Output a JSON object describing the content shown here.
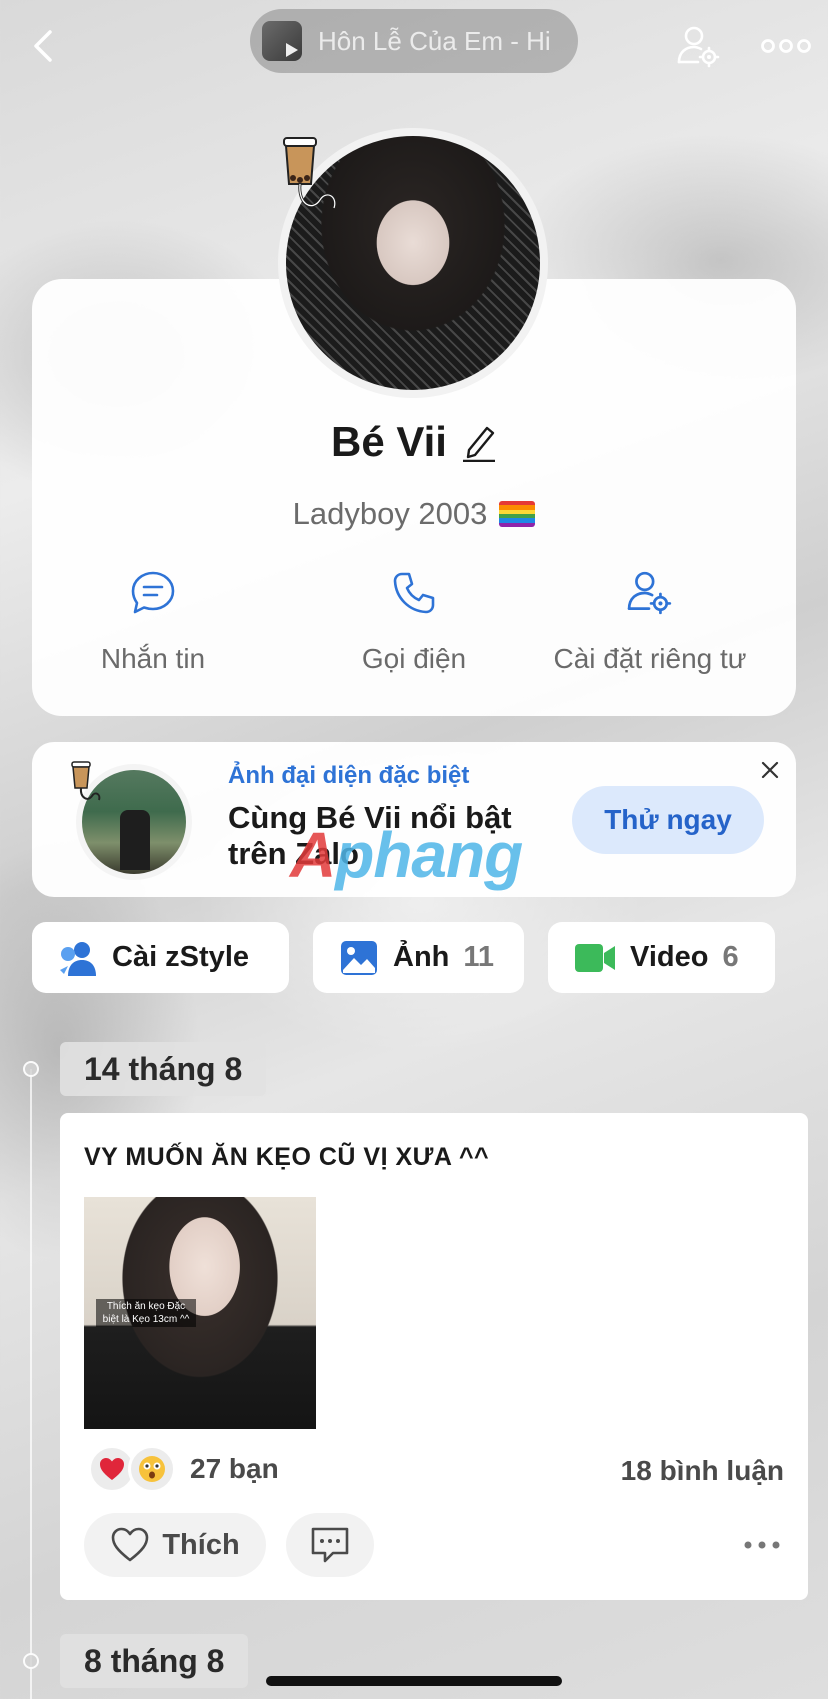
{
  "header": {
    "music_title": "Hôn Lễ Của Em - Hi"
  },
  "profile": {
    "name": "Bé Vii",
    "bio": "Ladyboy 2003",
    "actions": [
      {
        "label": "Nhắn tin",
        "icon": "chat-icon"
      },
      {
        "label": "Gọi điện",
        "icon": "phone-icon"
      },
      {
        "label": "Cài đặt riêng tư",
        "icon": "privacy-settings-icon"
      }
    ]
  },
  "promo": {
    "kicker": "Ảnh đại diện đặc biệt",
    "title": "Cùng Bé Vii nổi bật trên Zalo",
    "button_label": "Thử ngay"
  },
  "watermark": {
    "prefix": "A",
    "rest": "phang"
  },
  "quick_buttons": [
    {
      "label": "Cài zStyle",
      "count": "",
      "icon": "zstyle-icon"
    },
    {
      "label": "Ảnh",
      "count": "11",
      "icon": "photo-icon"
    },
    {
      "label": "Video",
      "count": "6",
      "icon": "video-icon"
    }
  ],
  "timeline": [
    {
      "date": "14 tháng 8",
      "post": {
        "text": "VY MUỐN ĂN KẸO CŨ VỊ XƯA ^^",
        "photo_caption": "Thích ăn kẹo Đặc biệt là Kẹo 13cm ^^",
        "reactions": [
          "heart",
          "surprised"
        ],
        "reaction_count": "27 bạn",
        "comment_count": "18 bình luận",
        "like_label": "Thích"
      }
    },
    {
      "date": "8 tháng 8"
    }
  ],
  "colors": {
    "accent": "#2e73d6",
    "button_bg": "#dce9fc",
    "video_green": "#3cba5a"
  }
}
